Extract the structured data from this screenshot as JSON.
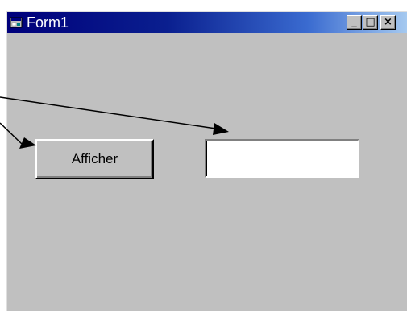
{
  "window": {
    "title": "Form1",
    "controls": {
      "minimize": "_",
      "maximize": "□",
      "close": "×"
    },
    "icons": {
      "app": "form-window-icon"
    }
  },
  "form": {
    "button_label": "Afficher",
    "textbox_value": "",
    "textbox_placeholder": ""
  },
  "colors": {
    "face": "#c0c0c0",
    "titlebar_start": "#00007b",
    "titlebar_end": "#a6caf0",
    "annotation": "#000000"
  }
}
